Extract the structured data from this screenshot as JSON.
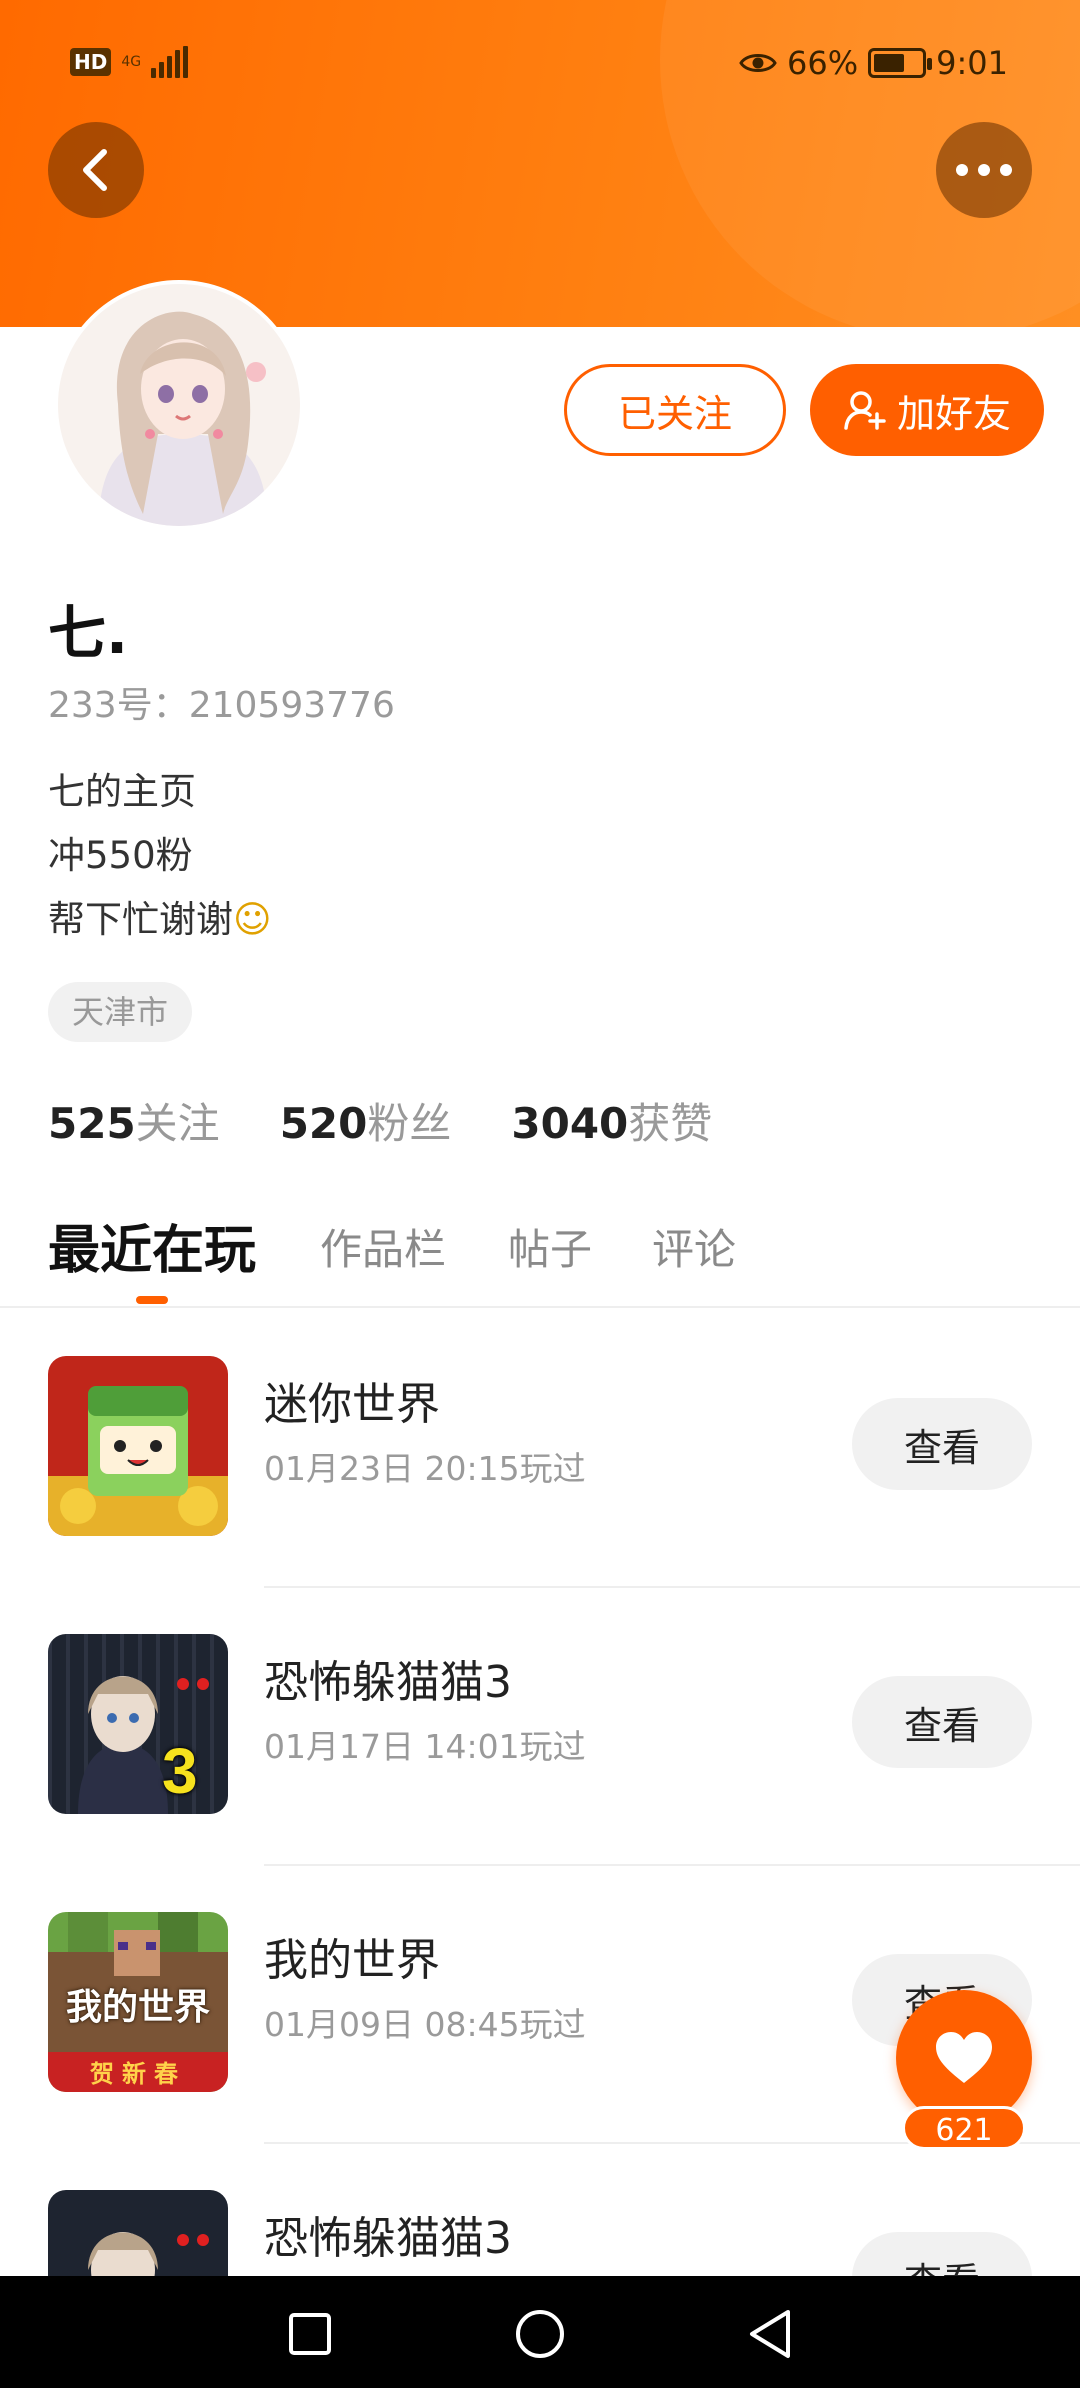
{
  "status_bar": {
    "hd": "HD",
    "network": "4G",
    "battery_percent": "66%",
    "battery_level": 0.66,
    "time": "9:01"
  },
  "header": {
    "back_icon": "chevron-left-icon",
    "more_icon": "more-dots-icon",
    "background_color": "#ff7a0d"
  },
  "profile": {
    "follow_label": "已关注",
    "add_friend_label": "加好友",
    "name": "七.",
    "id_text": "233号：210593776",
    "bio_lines": [
      "七的主页",
      "冲550粉",
      "帮下忙谢谢"
    ],
    "bio_emoji": "☺",
    "location": "天津市",
    "stats": [
      {
        "num": "525",
        "label": "关注"
      },
      {
        "num": "520",
        "label": "粉丝"
      },
      {
        "num": "3040",
        "label": "获赞"
      }
    ]
  },
  "tabs": [
    {
      "label": "最近在玩",
      "active": true
    },
    {
      "label": "作品栏",
      "active": false
    },
    {
      "label": "帖子",
      "active": false
    },
    {
      "label": "评论",
      "active": false
    }
  ],
  "games": [
    {
      "name": "迷你世界",
      "time": "01月23日 20:15玩过",
      "button": "查看"
    },
    {
      "name": "恐怖躲猫猫3",
      "time": "01月17日 14:01玩过",
      "button": "查看"
    },
    {
      "name": "我的世界",
      "time": "01月09日 08:45玩过",
      "button": "查看"
    },
    {
      "name": "恐怖躲猫猫3",
      "time": "",
      "button": "查看"
    }
  ],
  "game_icon_text": {
    "horror_number": "3",
    "minecraft_title": "我的世界",
    "minecraft_banner": "贺新春"
  },
  "like_float": {
    "icon": "heart-icon",
    "count": "621"
  },
  "accent_color": "#ff5f00"
}
